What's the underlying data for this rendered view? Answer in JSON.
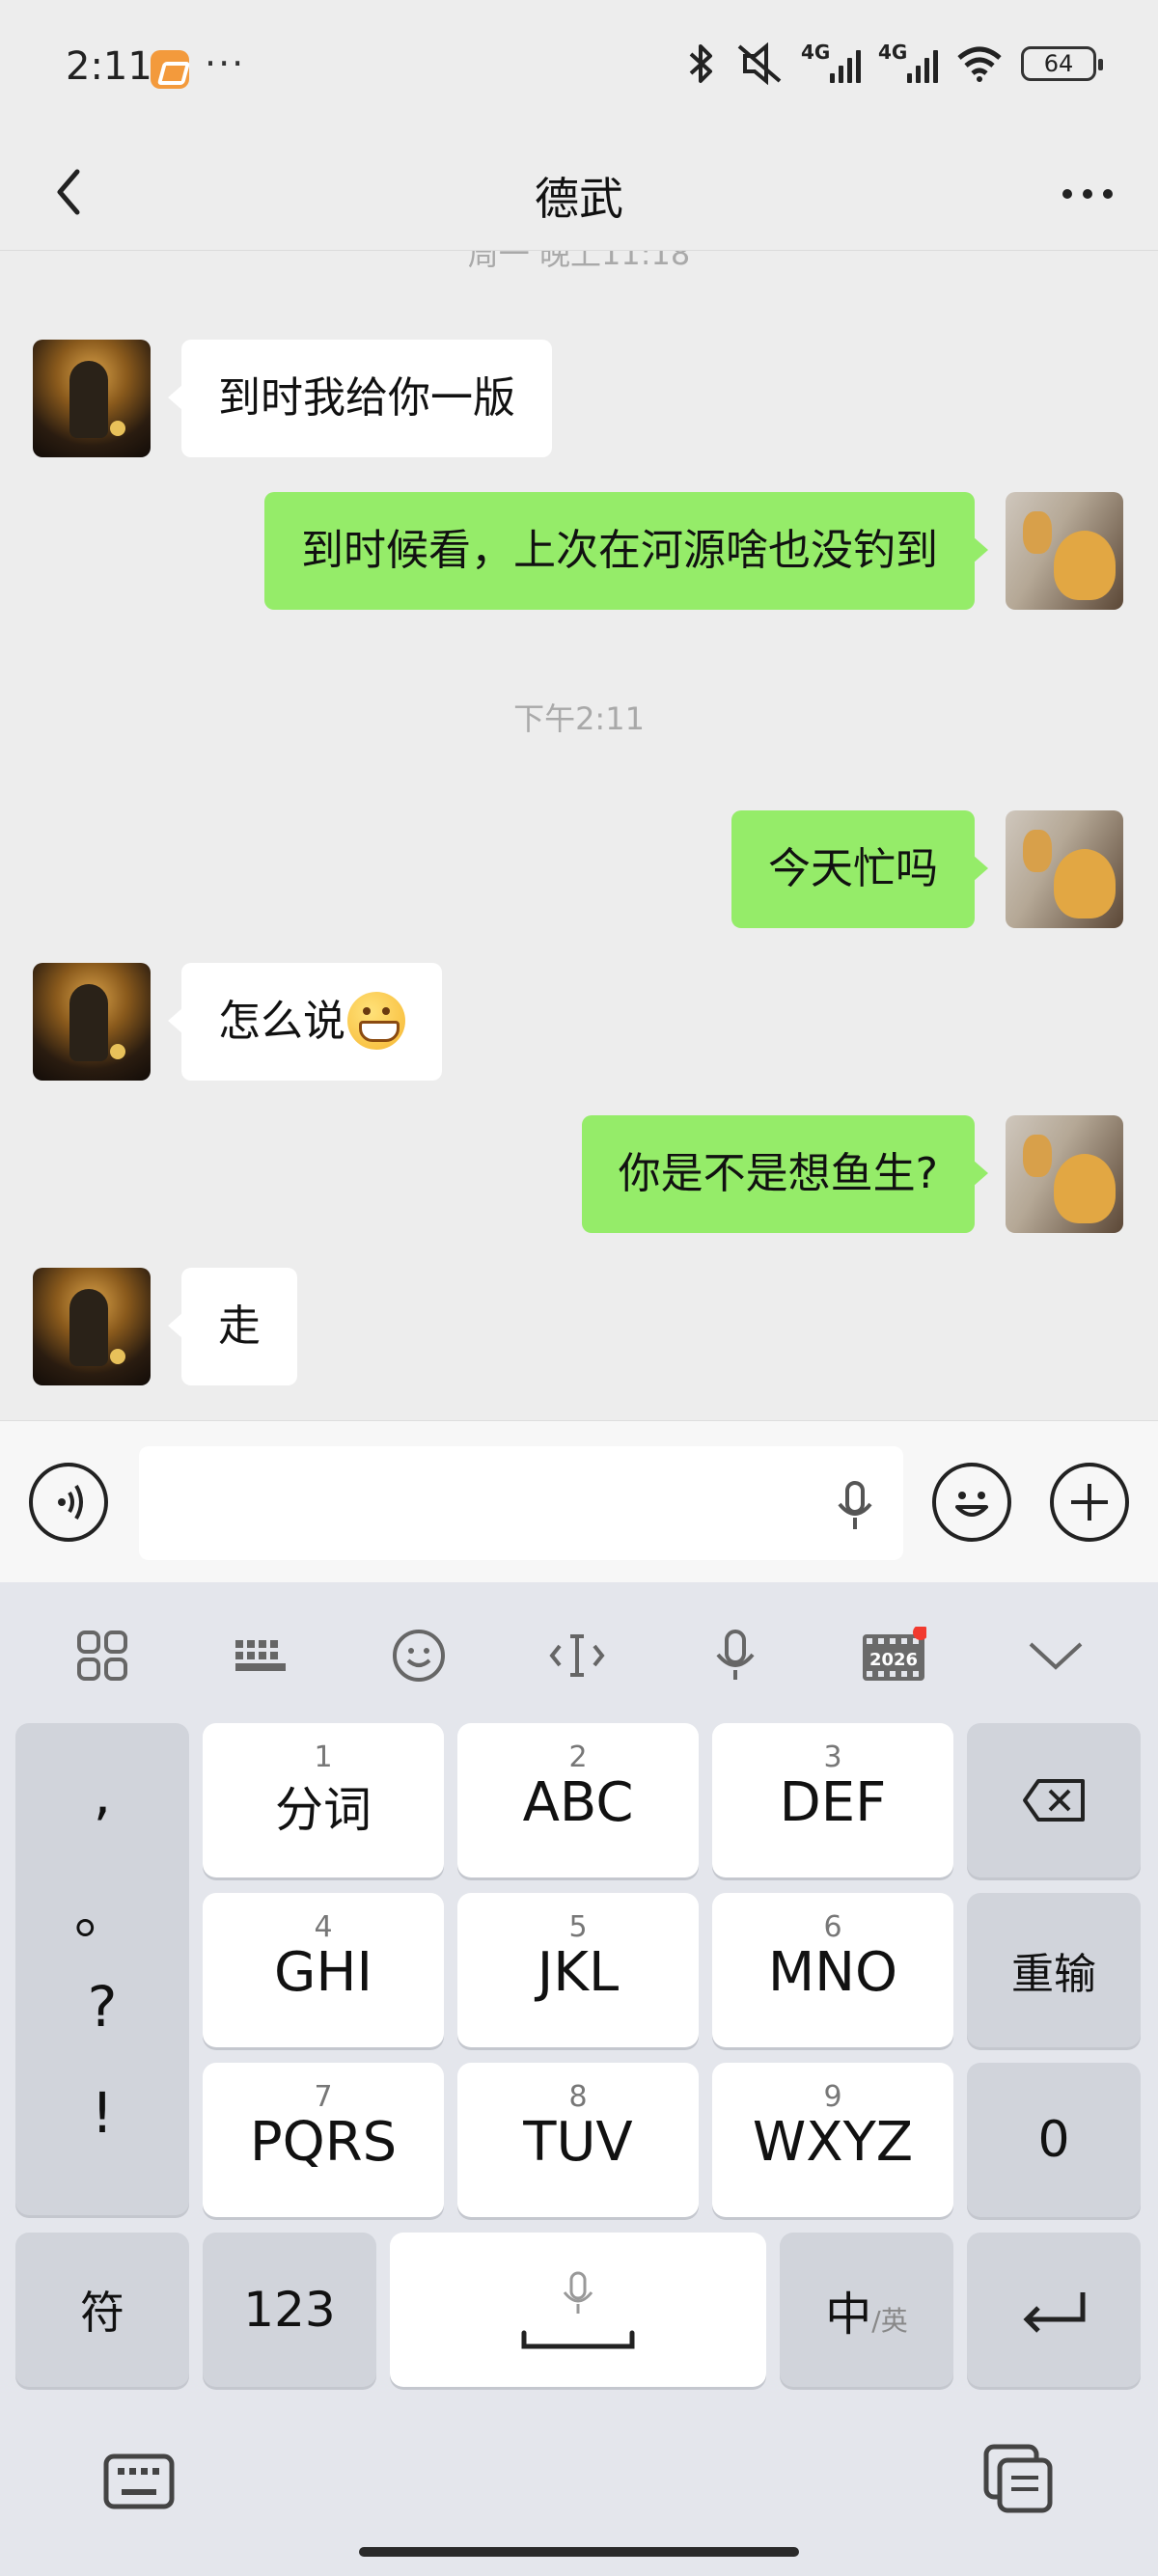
{
  "status_bar": {
    "time": "2:11",
    "more": "···",
    "signal_1": "4G",
    "signal_2": "4G",
    "battery": "64"
  },
  "header": {
    "title": "德武"
  },
  "chat": {
    "partial_timestamp": "周一 晚上11:18",
    "timestamp_2": "下午2:11",
    "messages": [
      {
        "from": "friend",
        "text": "到时我给你一版"
      },
      {
        "from": "me",
        "text": "到时候看，上次在河源啥也没钓到"
      },
      {
        "from": "me",
        "text": "今天忙吗"
      },
      {
        "from": "friend",
        "text": "怎么说",
        "emoji": "grinning-face-emoji"
      },
      {
        "from": "me",
        "text": "你是不是想鱼生?"
      },
      {
        "from": "friend",
        "text": "走"
      }
    ]
  },
  "input": {
    "value": ""
  },
  "keyboard": {
    "toolbar_icons": [
      "grid-icon",
      "keyboard-icon",
      "emoji-icon",
      "cursor-icon",
      "mic-icon",
      "calendar-2026-icon",
      "chevron-down-icon"
    ],
    "calendar_label": "2026",
    "punct": [
      ",",
      "。",
      "?",
      "!"
    ],
    "keys": [
      {
        "num": "1",
        "label": "分词"
      },
      {
        "num": "2",
        "label": "ABC"
      },
      {
        "num": "3",
        "label": "DEF"
      },
      {
        "num": "4",
        "label": "GHI"
      },
      {
        "num": "5",
        "label": "JKL"
      },
      {
        "num": "6",
        "label": "MNO"
      },
      {
        "num": "7",
        "label": "PQRS"
      },
      {
        "num": "8",
        "label": "TUV"
      },
      {
        "num": "9",
        "label": "WXYZ"
      }
    ],
    "reenter": "重输",
    "zero": "0",
    "symbols": "符",
    "numbers": "123",
    "lang_main": "中",
    "lang_alt": "/英"
  },
  "colors": {
    "outgoing_bubble": "#95ec69",
    "incoming_bubble": "#ffffff",
    "background": "#ededed",
    "notification_dot": "#f23a2f"
  }
}
